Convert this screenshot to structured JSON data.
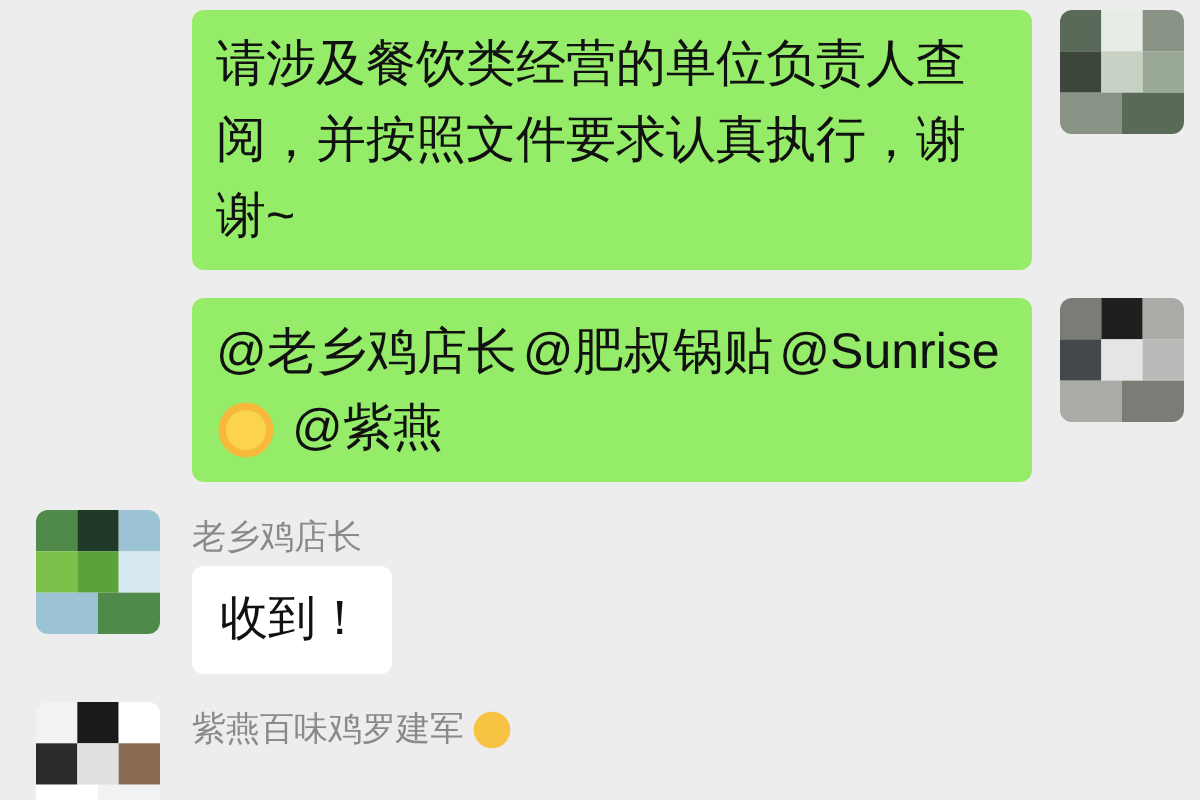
{
  "messages": [
    {
      "kind": "outgoing",
      "segments": [
        {
          "kind": "text",
          "text": "请涉及餐饮类经营的单位负责人查阅，并按照文件要求认真执行，谢谢~"
        }
      ]
    },
    {
      "kind": "outgoing",
      "segments": [
        {
          "kind": "text",
          "text": "@老乡鸡店长 @肥叔锅贴 @Sunrise"
        },
        {
          "kind": "sun_emoji"
        },
        {
          "kind": "text",
          "text": "@紫燕"
        }
      ]
    },
    {
      "kind": "incoming",
      "sender": "老乡鸡店长",
      "sender_emoji": false,
      "segments": [
        {
          "kind": "text",
          "text": "收到！"
        }
      ]
    },
    {
      "kind": "incoming",
      "sender": "紫燕百味鸡罗建军",
      "sender_emoji": true
    }
  ]
}
